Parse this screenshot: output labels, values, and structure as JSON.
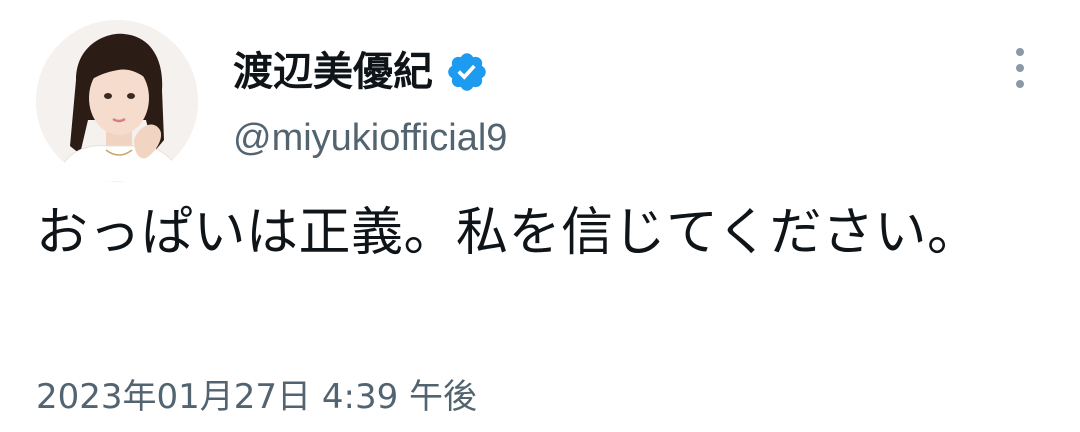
{
  "tweet": {
    "author": {
      "display_name": "渡辺美優紀",
      "handle": "@miyukiofficial9",
      "verified": true,
      "verified_icon": "verified-badge-icon",
      "avatar_icon": "profile-photo"
    },
    "text": "おっぱいは正義。私を信じてください。",
    "timestamp": "2023年01月27日 4:39 午後",
    "more_icon": "more-vertical-icon"
  },
  "colors": {
    "primary_text": "#0f1419",
    "secondary_text": "#536471",
    "verified_blue": "#1d9bf0",
    "background": "#ffffff"
  }
}
